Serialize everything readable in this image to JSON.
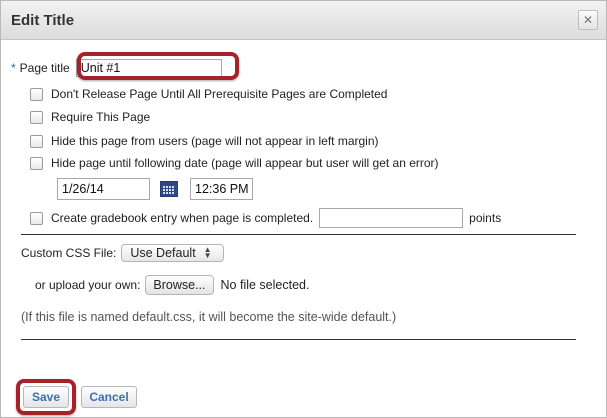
{
  "dialog": {
    "title": "Edit Title",
    "close_glyph": "✕"
  },
  "form": {
    "page_title": {
      "required_marker": "*",
      "label": "Page title",
      "value": "Unit #1"
    },
    "options": [
      {
        "label": "Don't Release Page Until All Prerequisite Pages are Completed",
        "checked": false
      },
      {
        "label": "Require This Page",
        "checked": false
      },
      {
        "label": "Hide this page from users (page will not appear in left margin)",
        "checked": false
      },
      {
        "label": "Hide page until following date (page will appear but user will get an error)",
        "checked": false
      }
    ],
    "release_date": "1/26/14",
    "release_time": "12:36 PM",
    "gradebook": {
      "label": "Create gradebook entry when page is completed.",
      "points_value": "",
      "points_label": "points",
      "checked": false
    },
    "css": {
      "label": "Custom CSS File:",
      "selected": "Use Default",
      "upload_label": "or upload your own:",
      "browse_label": "Browse...",
      "file_status": "No file selected.",
      "note": "(If this file is named default.css, it will become the site-wide default.)"
    }
  },
  "buttons": {
    "save": "Save",
    "cancel": "Cancel"
  },
  "colors": {
    "highlight": "#a4232a",
    "link_blue": "#3f6fb1",
    "required_star": "#1a6fbf"
  },
  "icons": {
    "calendar": "calendar-icon",
    "close": "close-icon"
  }
}
